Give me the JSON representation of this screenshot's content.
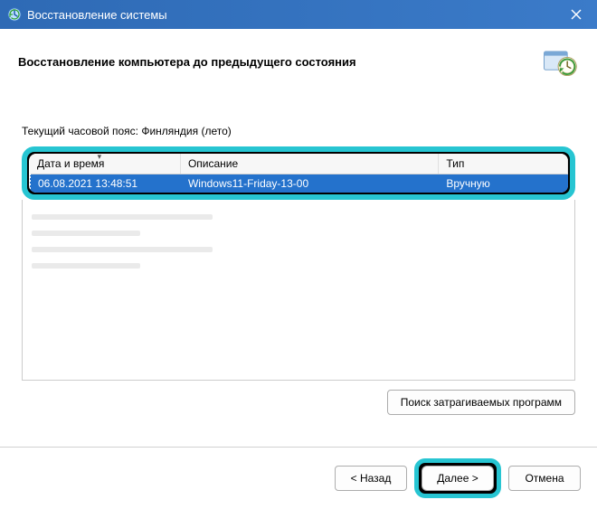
{
  "titlebar": {
    "title": "Восстановление системы"
  },
  "header": {
    "title": "Восстановление компьютера до предыдущего состояния"
  },
  "timezone_label": "Текущий часовой пояс: Финляндия (лето)",
  "table": {
    "columns": {
      "datetime": "Дата и время",
      "description": "Описание",
      "type": "Тип"
    },
    "rows": [
      {
        "datetime": "06.08.2021 13:48:51",
        "description": "Windows11-Friday-13-00",
        "type": "Вручную"
      }
    ]
  },
  "buttons": {
    "scan_affected": "Поиск затрагиваемых программ",
    "back": "< Назад",
    "next": "Далее >",
    "cancel": "Отмена"
  }
}
